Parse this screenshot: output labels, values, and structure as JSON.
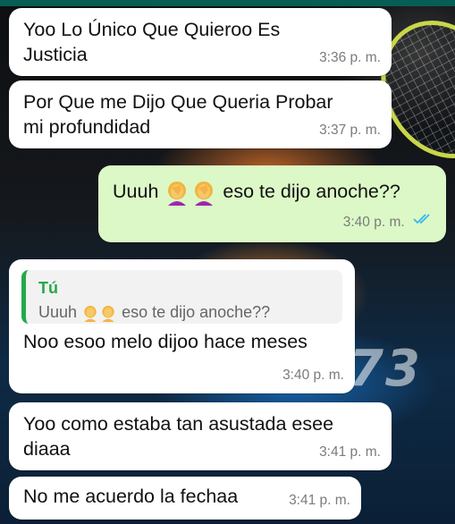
{
  "messages": [
    {
      "direction": "in",
      "lines": [
        "Yoo Lo Único Que Quieroo Es",
        "Justicia"
      ],
      "time": "3:36 p. m."
    },
    {
      "direction": "in",
      "lines": [
        "Por Que me Dijo Que Queria Probar",
        "mi profundidad"
      ],
      "time": "3:37 p. m."
    },
    {
      "direction": "out",
      "text_before": "Uuuh",
      "emoji": [
        "face-palm-emoji",
        "face-palm-emoji"
      ],
      "text_after": "eso te dijo anoche??",
      "time": "3:40 p. m.",
      "status": "read"
    },
    {
      "direction": "in",
      "reply_to": {
        "author": "Tú",
        "text_before": "Uuuh",
        "emoji": [
          "face-palm-emoji",
          "face-palm-emoji"
        ],
        "text_after": "eso te dijo anoche??"
      },
      "text": "Noo esoo melo dijoo hace meses",
      "time": "3:40 p. m."
    },
    {
      "direction": "in",
      "lines": [
        "Yoo como estaba tan asustada esee",
        "diaaa"
      ],
      "time": "3:41 p. m."
    },
    {
      "direction": "in",
      "text": "No me acuerdo la fechaa",
      "time": "3:41 p. m."
    }
  ],
  "colors": {
    "incoming_bubble": "#ffffff",
    "outgoing_bubble": "#dcf8c6",
    "read_check": "#34b7f1",
    "reply_author": "#25a84b",
    "top_bar": "#075e54"
  }
}
